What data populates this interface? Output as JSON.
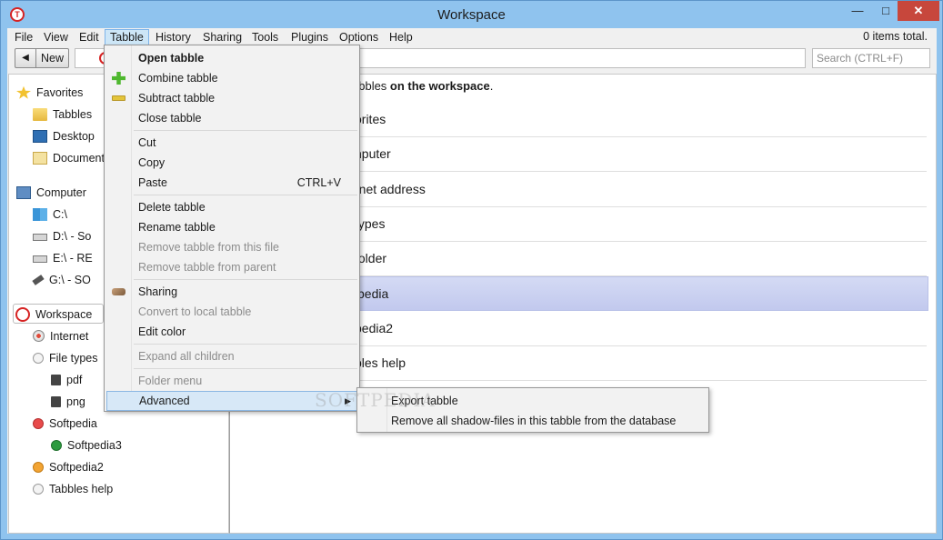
{
  "window": {
    "title": "Workspace",
    "app_icon": "tabbles-logo-icon",
    "accent": "#8fc3ee"
  },
  "menubar": {
    "items": [
      "File",
      "View",
      "Edit",
      "Tabble",
      "History",
      "Sharing",
      "Tools",
      "Plugins",
      "Options",
      "Help"
    ],
    "active": "Tabble",
    "status": "0 items total."
  },
  "toolbar": {
    "new_label": "New",
    "search_placeholder": "Search (CTRL+F)"
  },
  "sidebar": {
    "favorites": {
      "label": "Favorites",
      "children": [
        "Tabbles",
        "Desktop",
        "Documents"
      ]
    },
    "computer": {
      "label": "Computer",
      "children": [
        "C:\\",
        "D:\\ - So",
        "E:\\ - RE",
        "G:\\ - SO"
      ]
    },
    "workspace": {
      "label": "Workspace",
      "children": [
        "Internet",
        "File types",
        "pdf",
        "png",
        "Softpedia",
        "Softpedia3",
        "Softpedia2",
        "Tabbles help"
      ]
    }
  },
  "main": {
    "header_prefix": "abbles ",
    "header_bold": "on the workspace",
    "header_suffix": ".",
    "rows": [
      "orites",
      "nputer",
      "rnet address",
      "types",
      "folder",
      "pedia",
      "pedia2",
      "bles help"
    ],
    "selected_index": 5,
    "selected_color": "#c8cff0"
  },
  "dropdown": {
    "items": {
      "open": "Open tabble",
      "combine": "Combine tabble",
      "subtract": "Subtract tabble",
      "close": "Close tabble",
      "cut": "Cut",
      "copy": "Copy",
      "paste": "Paste",
      "paste_shortcut": "CTRL+V",
      "delete": "Delete tabble",
      "rename": "Rename tabble",
      "remove_file": "Remove tabble from this file",
      "remove_parent": "Remove tabble from parent",
      "sharing": "Sharing",
      "convert": "Convert to local tabble",
      "edit_color": "Edit color",
      "expand": "Expand all children",
      "folder_menu": "Folder menu",
      "advanced": "Advanced"
    }
  },
  "submenu": {
    "export": "Export tabble",
    "remove_shadow": "Remove all shadow-files in this tabble from the database"
  },
  "watermark": "SOFTPEDIA"
}
